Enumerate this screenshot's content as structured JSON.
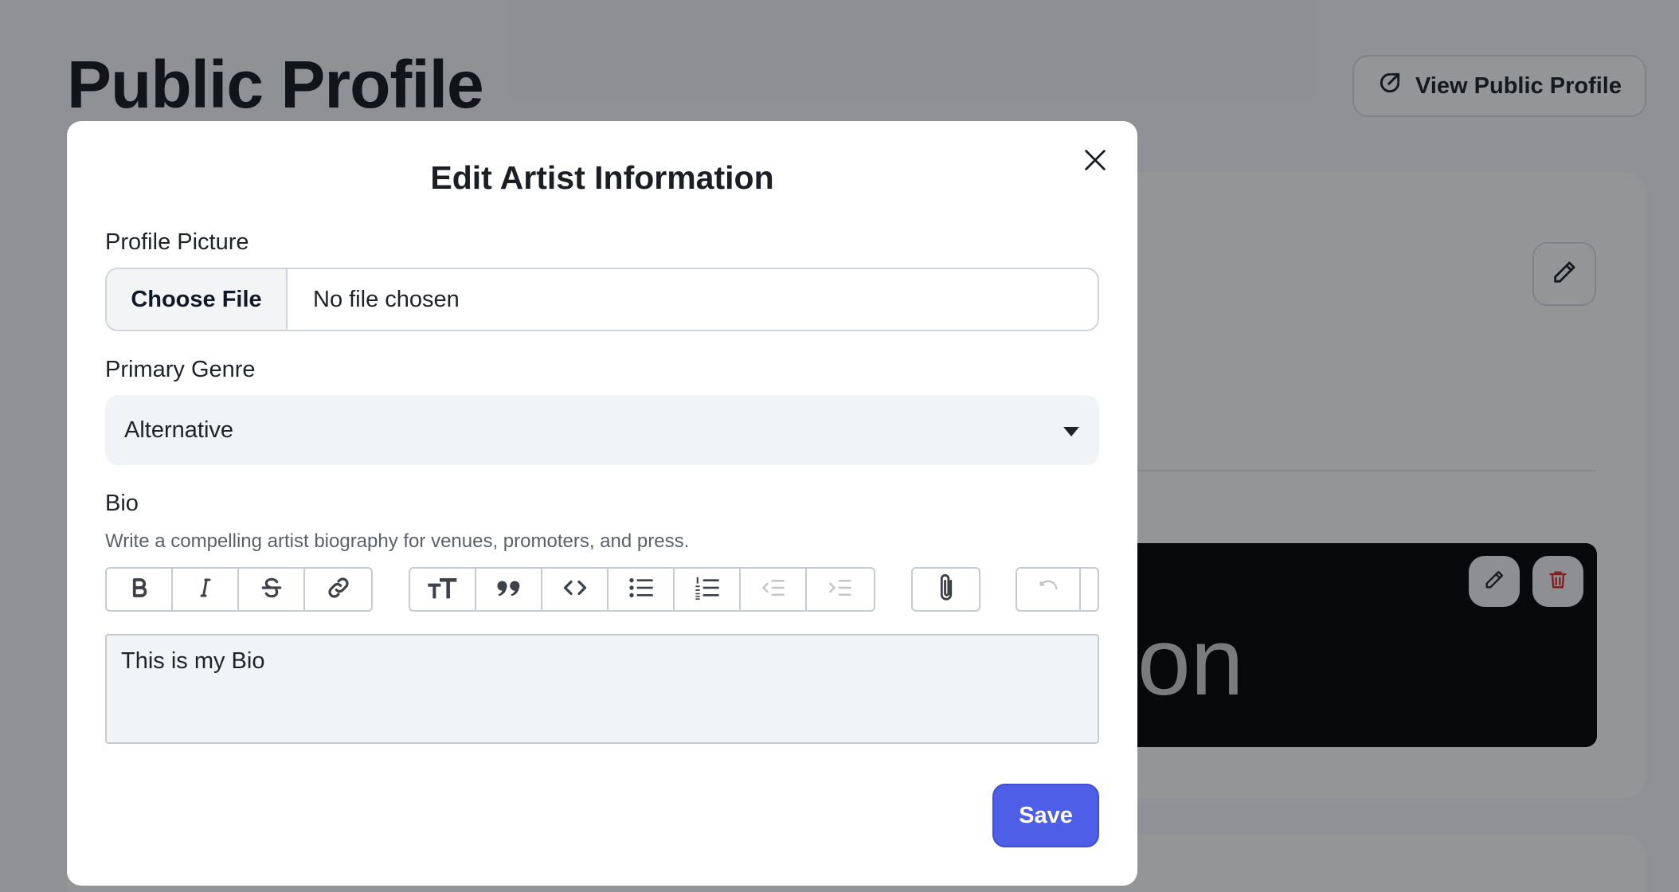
{
  "page": {
    "title": "Public Profile",
    "view_public_profile_label": "View Public Profile",
    "banner_text": "on"
  },
  "modal": {
    "title": "Edit Artist Information",
    "profile_picture": {
      "label": "Profile Picture",
      "choose_file_label": "Choose File",
      "status": "No file chosen"
    },
    "primary_genre": {
      "label": "Primary Genre",
      "selected": "Alternative"
    },
    "bio": {
      "label": "Bio",
      "hint": "Write a compelling artist biography for venues, promoters, and press.",
      "value": "This is my Bio",
      "toolbar": [
        [
          "bold-icon",
          "italic-icon",
          "strikethrough-icon",
          "link-icon"
        ],
        [
          "heading-icon",
          "quote-icon",
          "code-icon",
          "bullet-list-icon",
          "numbered-list-icon",
          "outdent-icon",
          "indent-icon"
        ],
        [
          "attachment-icon"
        ],
        [
          "undo-icon"
        ]
      ]
    },
    "save_label": "Save"
  },
  "colors": {
    "accent": "#4f5ee6",
    "delete": "#dc2626"
  }
}
